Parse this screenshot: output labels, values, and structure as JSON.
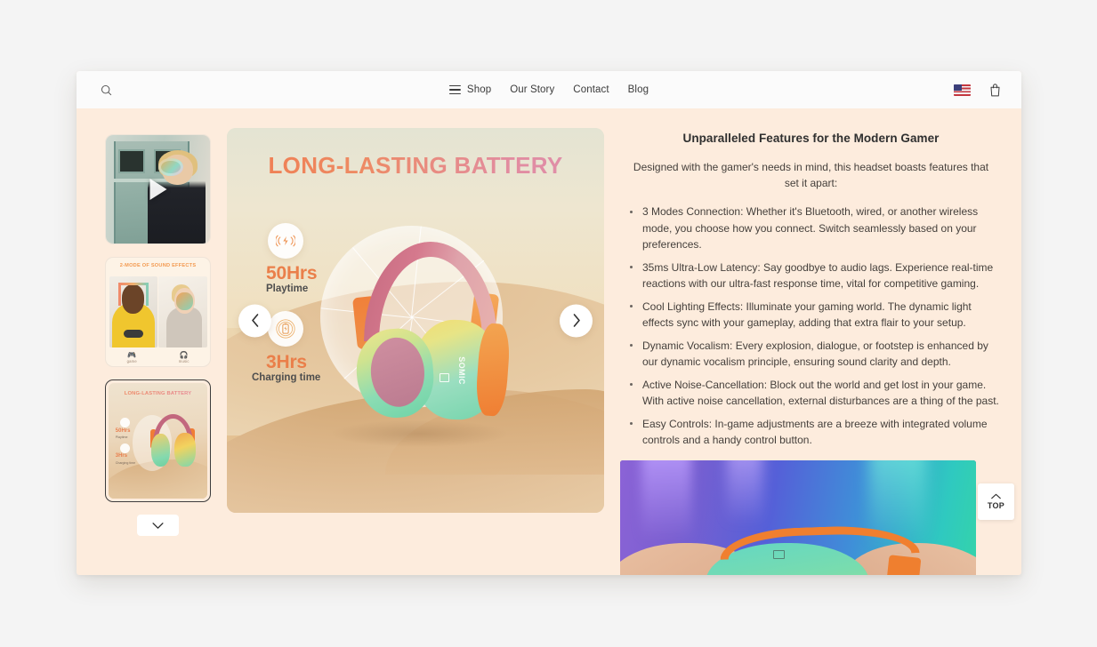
{
  "header": {
    "search_icon": "search-icon",
    "nav": [
      {
        "label": "Shop",
        "has_menu_icon": true
      },
      {
        "label": "Our Story",
        "has_menu_icon": false
      },
      {
        "label": "Contact",
        "has_menu_icon": false
      },
      {
        "label": "Blog",
        "has_menu_icon": false
      }
    ],
    "locale_flag": "us-flag-icon",
    "cart_icon": "shopping-bag-icon"
  },
  "gallery": {
    "thumbnails": [
      {
        "name": "video-thumbnail",
        "type": "video",
        "selected": false,
        "caption": ""
      },
      {
        "name": "sound-effects-thumbnail",
        "type": "image",
        "selected": false,
        "caption": "2-MODE OF SOUND EFFECTS",
        "mode_game": "game",
        "mode_music": "music"
      },
      {
        "name": "battery-thumbnail",
        "type": "image",
        "selected": true,
        "caption": "LONG-LASTING BATTERY"
      }
    ],
    "next_thumbnails_icon": "chevron-down-icon",
    "prev_arrow_icon": "chevron-left-icon",
    "next_arrow_icon": "chevron-right-icon"
  },
  "stage": {
    "title": "LONG-LASTING BATTERY",
    "title_gradient_from": "#f07c4f",
    "title_gradient_to": "#dd8fae",
    "stats": [
      {
        "value": "50Hrs",
        "label": "Playtime",
        "icon": "wireless-charging-icon"
      },
      {
        "value": "3Hrs",
        "label": "Charging time",
        "icon": "battery-icon"
      }
    ],
    "brand_logo": "SOMIC",
    "accent_color": "#ea7f4a"
  },
  "content": {
    "title": "Unparalleled Features for the Modern Gamer",
    "intro": "Designed with the gamer's needs in mind, this headset boasts features that set it apart:",
    "features": [
      "3 Modes Connection: Whether it's Bluetooth, wired, or another wireless mode, you choose how you connect. Switch seamlessly based on your preferences.",
      "35ms Ultra-Low Latency: Say goodbye to audio lags. Experience real-time reactions with our ultra-fast response time, vital for competitive gaming.",
      "Cool Lighting Effects: Illuminate your gaming world. The dynamic light effects sync with your gameplay, adding that extra flair to your setup.",
      "Dynamic Vocalism: Every explosion, dialogue, or footstep is enhanced by our dynamic vocalism principle, ensuring sound clarity and depth.",
      "Active Noise-Cancellation: Block out the world and get lost in your game. With active noise cancellation, external disturbances are a thing of the past.",
      "Easy Controls: In-game adjustments are a breeze with integrated volume controls and a handy control button."
    ]
  },
  "scroll_top": {
    "label": "TOP",
    "icon": "chevron-up-icon"
  }
}
